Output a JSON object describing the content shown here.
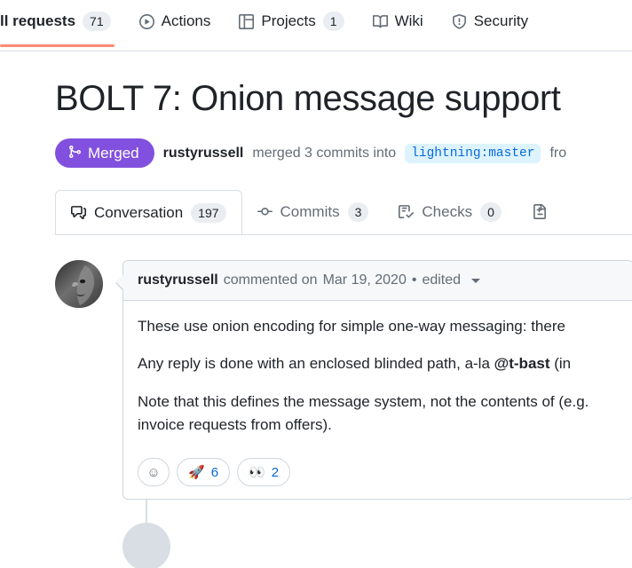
{
  "repo_nav": {
    "items": [
      {
        "label": "ll requests",
        "count": "71",
        "icon": "pull-request-icon",
        "active": true,
        "truncated": true
      },
      {
        "label": "Actions",
        "count": null,
        "icon": "play-icon",
        "active": false
      },
      {
        "label": "Projects",
        "count": "1",
        "icon": "table-icon",
        "active": false
      },
      {
        "label": "Wiki",
        "count": null,
        "icon": "book-icon",
        "active": false
      },
      {
        "label": "Security",
        "count": null,
        "icon": "shield-icon",
        "active": false
      }
    ]
  },
  "pull_request": {
    "title": "BOLT 7: Onion message support",
    "state": {
      "label": "Merged",
      "color": "#8250df",
      "icon": "git-merge-icon"
    },
    "meta": {
      "author": "rustyrussell",
      "action_text": "merged 3 commits into",
      "base_branch": "lightning:master",
      "trailing_text": "fro"
    }
  },
  "tabs": [
    {
      "label": "Conversation",
      "count": "197",
      "icon": "comment-discussion-icon",
      "active": true
    },
    {
      "label": "Commits",
      "count": "3",
      "icon": "git-commit-icon",
      "active": false
    },
    {
      "label": "Checks",
      "count": "0",
      "icon": "checklist-icon",
      "active": false
    },
    {
      "label": "",
      "count": null,
      "icon": "file-diff-icon",
      "active": false
    }
  ],
  "comment": {
    "author": "rustyrussell",
    "action": "commented on",
    "date": "Mar 19, 2020",
    "separator": "•",
    "edited_label": "edited",
    "avatar": "user-avatar",
    "paragraphs": [
      "These use onion encoding for simple one-way messaging: there",
      "Any reply is done with an enclosed blinded path, a-la ",
      "Note that this defines the message system, not the contents of (e.g. invoice requests from offers)."
    ],
    "mention": "@t-bast",
    "mention_suffix": " (in",
    "reactions": [
      {
        "name": "add-reaction",
        "emoji": "☺",
        "count": null
      },
      {
        "name": "rocket",
        "emoji": "🚀",
        "count": "6"
      },
      {
        "name": "eyes",
        "emoji": "👀",
        "count": "2"
      }
    ]
  }
}
